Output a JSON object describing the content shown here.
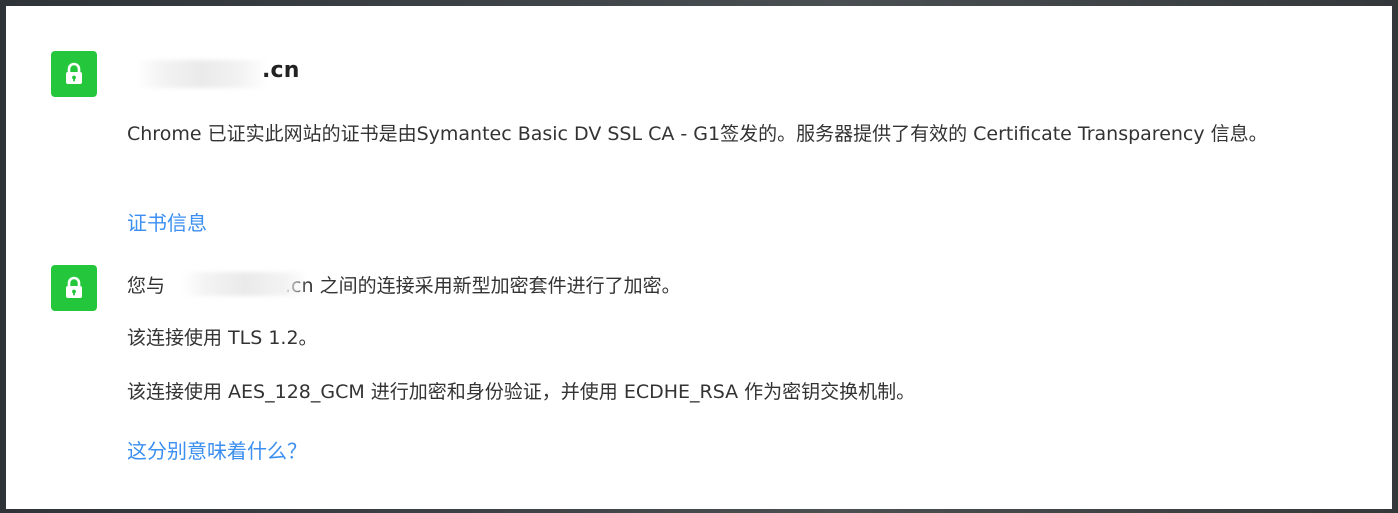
{
  "certificate": {
    "site_suffix": ".cn",
    "description": "Chrome 已证实此网站的证书是由Symantec Basic DV SSL CA - G1签发的。服务器提供了有效的 Certificate Transparency 信息。",
    "link_label": "证书信息"
  },
  "connection": {
    "prefix": "您与",
    "suffix": ".cn 之间的连接采用新型加密套件进行了加密。",
    "tls_line": "该连接使用 TLS 1.2。",
    "cipher_line": "该连接使用 AES_128_GCM 进行加密和身份验证，并使用 ECDHE_RSA 作为密钥交换机制。",
    "link_label": "这分别意味着什么？"
  },
  "icons": {
    "certificate_icon": "lock-icon",
    "connection_icon": "lock-icon"
  },
  "colors": {
    "lock_badge": "#24c73b",
    "link": "#3b8ff0",
    "text": "#333333"
  }
}
